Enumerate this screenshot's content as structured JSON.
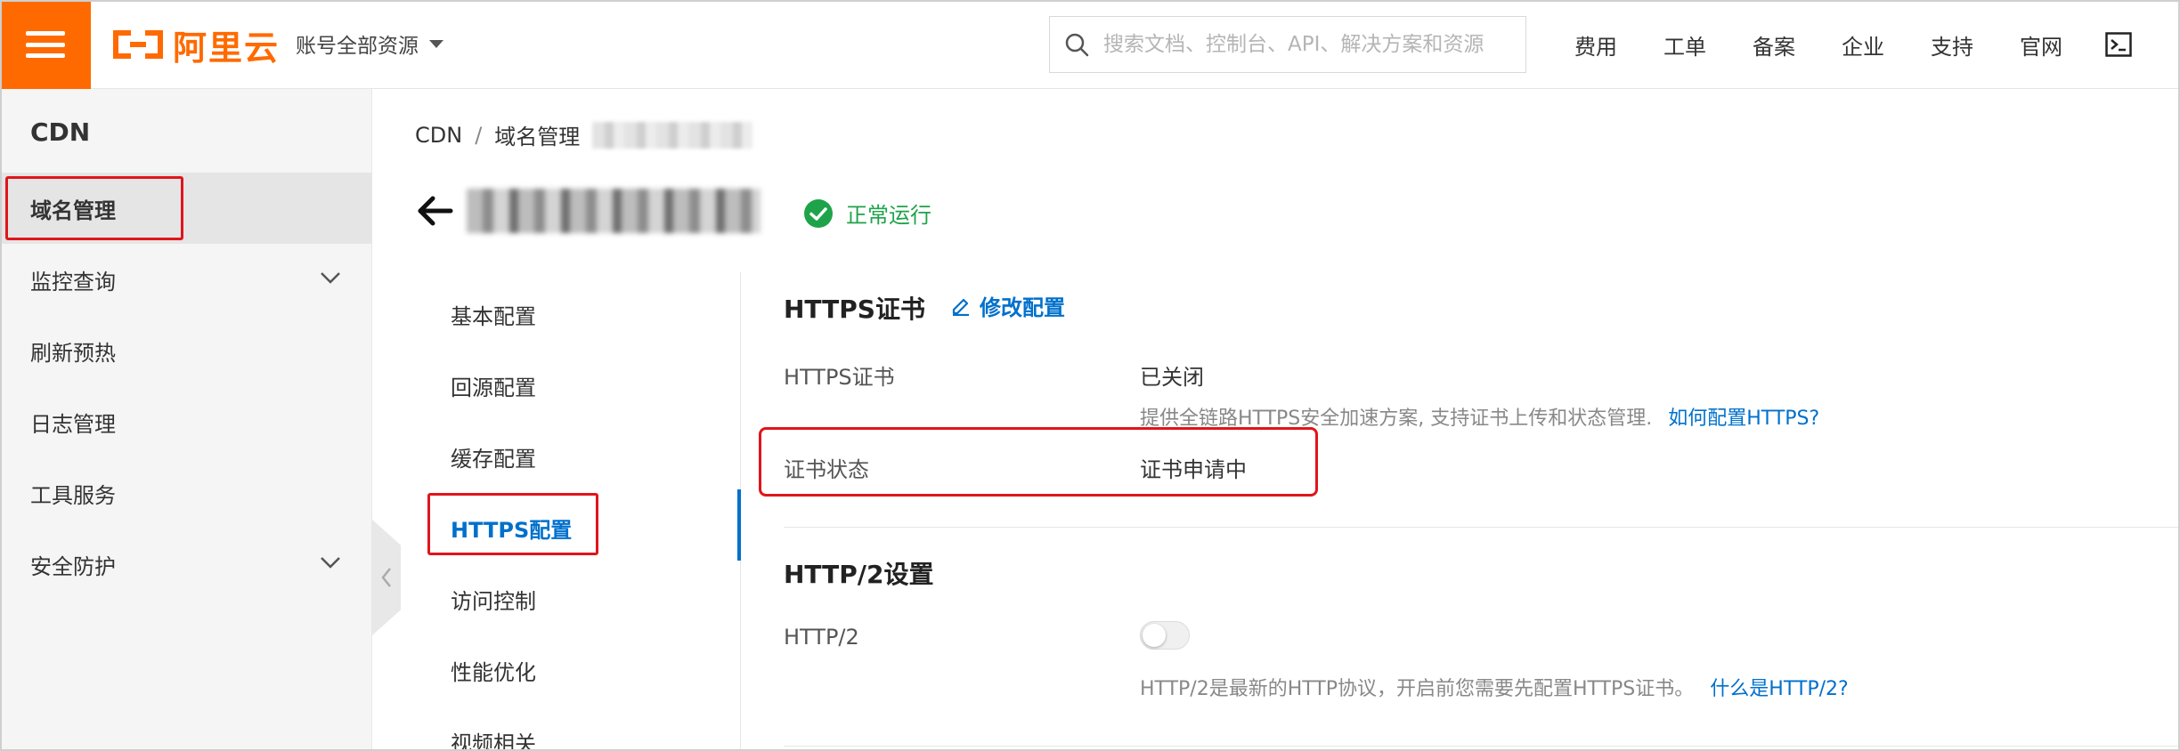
{
  "colors": {
    "brand": "#ff6a00",
    "link": "#0070cc",
    "success": "#1fa34a",
    "highlight": "#e0151b"
  },
  "topbar": {
    "menu_icon": "hamburger-icon",
    "logo_text": "阿里云",
    "account_label": "账号全部资源",
    "search_placeholder": "搜索文档、控制台、API、解决方案和资源",
    "nav": [
      "费用",
      "工单",
      "备案",
      "企业",
      "支持",
      "官网"
    ],
    "terminal_icon": "terminal-icon"
  },
  "sidebar": {
    "title": "CDN",
    "items": [
      {
        "label": "域名管理",
        "active": true,
        "expandable": false
      },
      {
        "label": "监控查询",
        "active": false,
        "expandable": true
      },
      {
        "label": "刷新预热",
        "active": false,
        "expandable": false
      },
      {
        "label": "日志管理",
        "active": false,
        "expandable": false
      },
      {
        "label": "工具服务",
        "active": false,
        "expandable": false
      },
      {
        "label": "安全防护",
        "active": false,
        "expandable": true
      }
    ]
  },
  "breadcrumb": {
    "root": "CDN",
    "separator": "/",
    "current": "域名管理"
  },
  "domain": {
    "status": "正常运行"
  },
  "subnav": {
    "items": [
      "基本配置",
      "回源配置",
      "缓存配置",
      "HTTPS配置",
      "访问控制",
      "性能优化",
      "视频相关"
    ],
    "active_index": 3
  },
  "https_section": {
    "title": "HTTPS证书",
    "edit_label": "修改配置",
    "cert_label": "HTTPS证书",
    "cert_value": "已关闭",
    "cert_hint": "提供全链路HTTPS安全加速方案, 支持证书上传和状态管理.",
    "cert_help_link": "如何配置HTTPS?",
    "status_label": "证书状态",
    "status_value": "证书申请中"
  },
  "http2_section": {
    "title": "HTTP/2设置",
    "label": "HTTP/2",
    "enabled": false,
    "hint": "HTTP/2是最新的HTTP协议，开启前您需要先配置HTTPS证书。",
    "help_link": "什么是HTTP/2?"
  }
}
